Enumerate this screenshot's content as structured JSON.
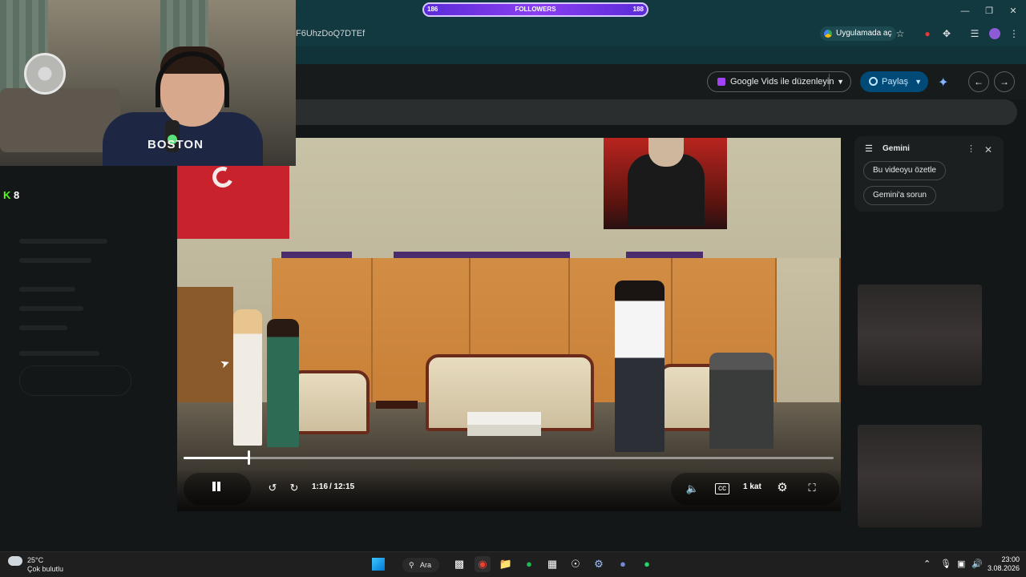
{
  "browser": {
    "url_fragment": "F6UhzDoQ7DTEf",
    "open_in_app_label": "Uygulamada aç"
  },
  "overlay": {
    "followers_label": "FOLLOWERS",
    "followers_left_count": "186",
    "followers_right_count": "188",
    "kick_viewers": "8"
  },
  "webcam": {
    "shirt_text": "BOSTON"
  },
  "drive": {
    "vids_button_label": "Google Vids ile düzenleyin",
    "share_button_label": "Paylaş"
  },
  "gemini": {
    "title": "Gemini",
    "chips": [
      "Bu videoyu özetle",
      "Gemini'a sorun"
    ]
  },
  "video": {
    "current_time": "1:16",
    "total_time": "/ 12:15",
    "progress": 0.1,
    "speed_label": "1 kat"
  },
  "taskbar": {
    "temperature": "25°C",
    "weather_desc": "Çok bulutlu",
    "search_label": "Ara",
    "time": "23:00",
    "date": "3.08.2026"
  },
  "colors": {
    "chrome_bg": "#12393f",
    "share_button": "#004a77",
    "kick_green": "#53fc18"
  }
}
